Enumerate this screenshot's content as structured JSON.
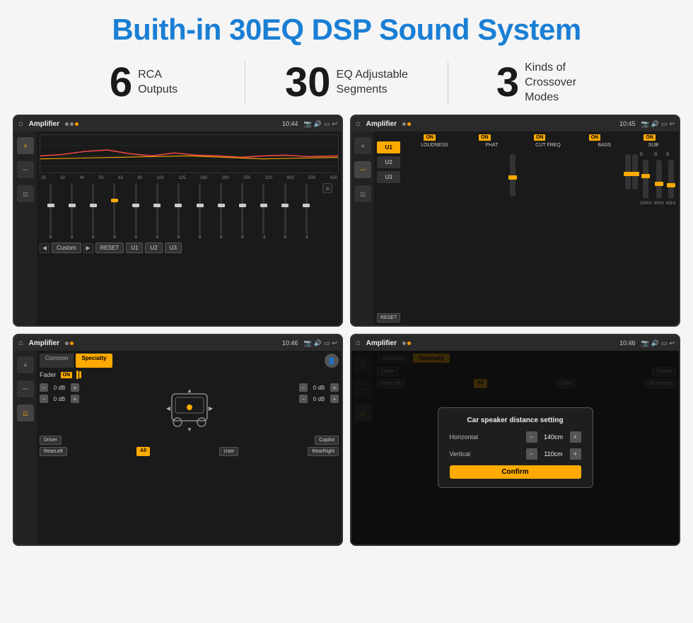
{
  "header": {
    "title": "Buith-in 30EQ DSP Sound System"
  },
  "stats": [
    {
      "number": "6",
      "label": "RCA\nOutputs"
    },
    {
      "number": "30",
      "label": "EQ Adjustable\nSegments"
    },
    {
      "number": "3",
      "label": "Kinds of\nCrossover Modes"
    }
  ],
  "screens": [
    {
      "id": "eq-screen",
      "statusBar": {
        "appName": "Amplifier",
        "time": "10:44"
      },
      "type": "eq"
    },
    {
      "id": "crossover-screen",
      "statusBar": {
        "appName": "Amplifier",
        "time": "10:45"
      },
      "type": "crossover"
    },
    {
      "id": "fader-screen",
      "statusBar": {
        "appName": "Amplifier",
        "time": "10:46"
      },
      "type": "fader"
    },
    {
      "id": "dialog-screen",
      "statusBar": {
        "appName": "Amplifier",
        "time": "10:46"
      },
      "type": "dialog"
    }
  ],
  "eq": {
    "freqLabels": [
      "25",
      "32",
      "40",
      "50",
      "63",
      "80",
      "100",
      "125",
      "160",
      "200",
      "250",
      "320",
      "400",
      "500",
      "630"
    ],
    "values": [
      "0",
      "0",
      "0",
      "5",
      "0",
      "0",
      "0",
      "0",
      "0",
      "0",
      "-1",
      "0",
      "-1"
    ],
    "preset": "Custom",
    "buttons": [
      "Custom",
      "RESET",
      "U1",
      "U2",
      "U3"
    ]
  },
  "crossover": {
    "uButtons": [
      "U1",
      "U2",
      "U3"
    ],
    "columns": [
      "LOUDNESS",
      "PHAT",
      "CUT FREQ",
      "BASS",
      "SUB"
    ],
    "resetLabel": "RESET"
  },
  "fader": {
    "tabs": [
      "Common",
      "Specialty"
    ],
    "faderLabel": "Fader",
    "onLabel": "ON",
    "dbValues": [
      "0 dB",
      "0 dB",
      "0 dB",
      "0 dB"
    ],
    "buttons": [
      "Driver",
      "RearLeft",
      "All",
      "User",
      "RearRight",
      "Copilot"
    ]
  },
  "dialog": {
    "title": "Car speaker distance setting",
    "horizontalLabel": "Horizontal",
    "horizontalValue": "140cm",
    "verticalLabel": "Vertical",
    "verticalValue": "110cm",
    "confirmLabel": "Confirm"
  }
}
